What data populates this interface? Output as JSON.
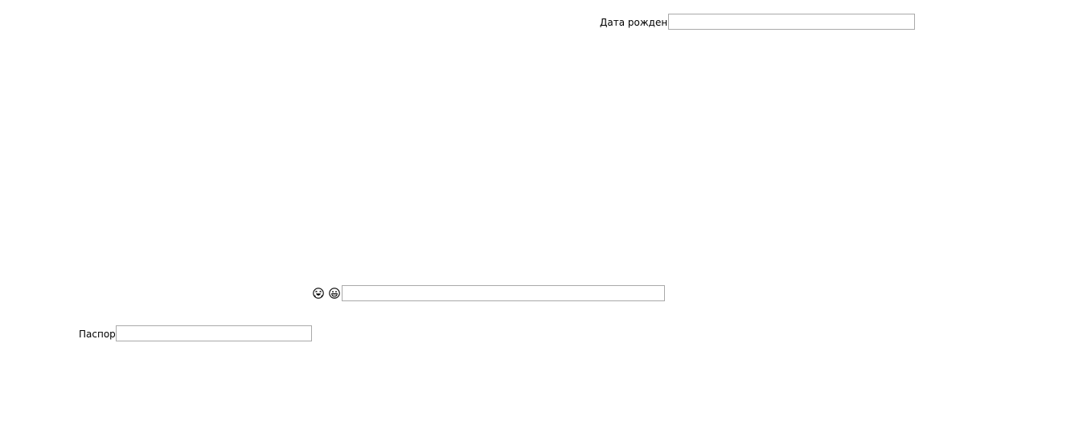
{
  "form": {
    "birth_date": {
      "label": "Дата рождения",
      "value": "",
      "placeholder": ""
    },
    "emoji_field": {
      "icons": [
        "rolling-on-floor-laughing-icon",
        "grinning-face-icon"
      ],
      "value": "",
      "placeholder": ""
    },
    "passport": {
      "label": "Паспорт",
      "value": "",
      "placeholder": ""
    }
  }
}
